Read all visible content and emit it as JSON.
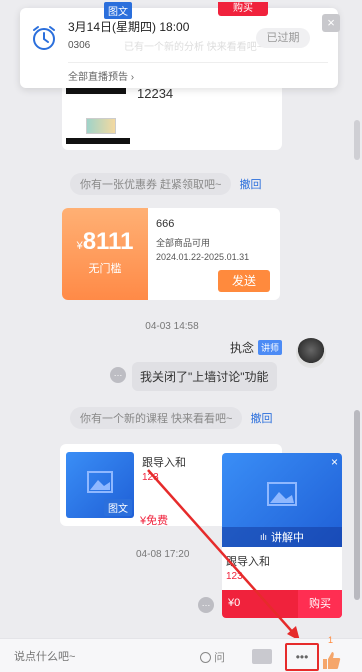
{
  "popup": {
    "top_tag": "图文",
    "top_buy": "购买",
    "datetime": "3月14日(星期四) 18:00",
    "code": "0306",
    "status": "已过期",
    "all_live_link": "全部直播预告",
    "faded_text": "已有一个新的分析 快来看看吧~",
    "close_symbol": "×"
  },
  "msg1": {
    "number": "12234"
  },
  "coupon_notice": {
    "text": "你有一张优惠券 赶紧领取吧~",
    "action": "撤回"
  },
  "coupon": {
    "symbol": "¥",
    "amount": "8111",
    "threshold": "无门槛",
    "title": "666",
    "scope": "全部商品可用",
    "validity": "2024.01.22-2025.01.31",
    "send": "发送"
  },
  "timestamp1": "04-03 14:58",
  "lecturer": {
    "name": "执念",
    "badge": "讲师",
    "message": "我关闭了\"上墙讨论\"功能"
  },
  "course_notice": {
    "text": "你有一个新的课程 快来看看吧~",
    "action": "撤回"
  },
  "course_card": {
    "tag": "图文",
    "title": "跟导入和",
    "sub": "123",
    "price": "¥免费"
  },
  "timestamp2": "04-08 17:20",
  "live_card": {
    "close_symbol": "×",
    "live_label": "讲解中",
    "title": "跟导入和",
    "sub": "123",
    "price": "¥0",
    "buy": "购买"
  },
  "bottom": {
    "input_placeholder": "说点什么吧~",
    "ask_label": "问",
    "more_symbol": "•••",
    "like_count": "1"
  },
  "colors": {
    "accent_blue": "#2b6fdc",
    "orange": "#ff8a3d",
    "red": "#f0223c",
    "highlight": "#e62b2b"
  }
}
